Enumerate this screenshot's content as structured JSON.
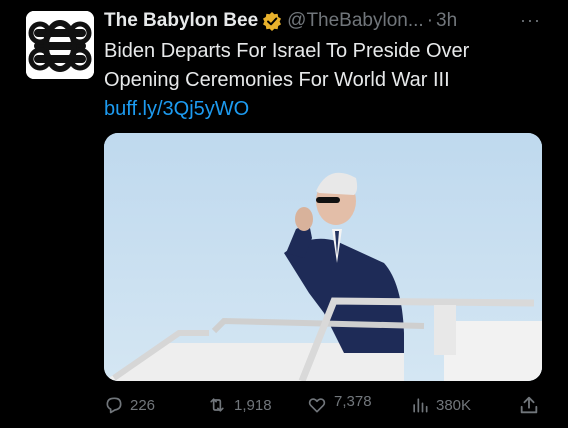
{
  "tweet": {
    "author_name": "The Babylon Bee",
    "handle": "@TheBabylon...",
    "separator": "·",
    "time": "3h",
    "more_label": "···",
    "text": "Biden Departs For Israel To Preside Over Opening Ceremonies For World War III",
    "link": "buff.ly/3Qj5yWO"
  },
  "actions": {
    "replies": "226",
    "retweets": "1,918",
    "likes": "7,378",
    "views": "380K"
  },
  "icons": {
    "avatar": "babylon-bee-logo",
    "verified": "verified-badge-icon",
    "reply": "reply-icon",
    "retweet": "retweet-icon",
    "like": "heart-icon",
    "views": "views-chart-icon",
    "share": "share-icon"
  },
  "colors": {
    "background": "#000000",
    "text": "#e7e9ea",
    "secondary": "#71767b",
    "link": "#1d9bf0",
    "verified_badge": "#e8b12c"
  }
}
